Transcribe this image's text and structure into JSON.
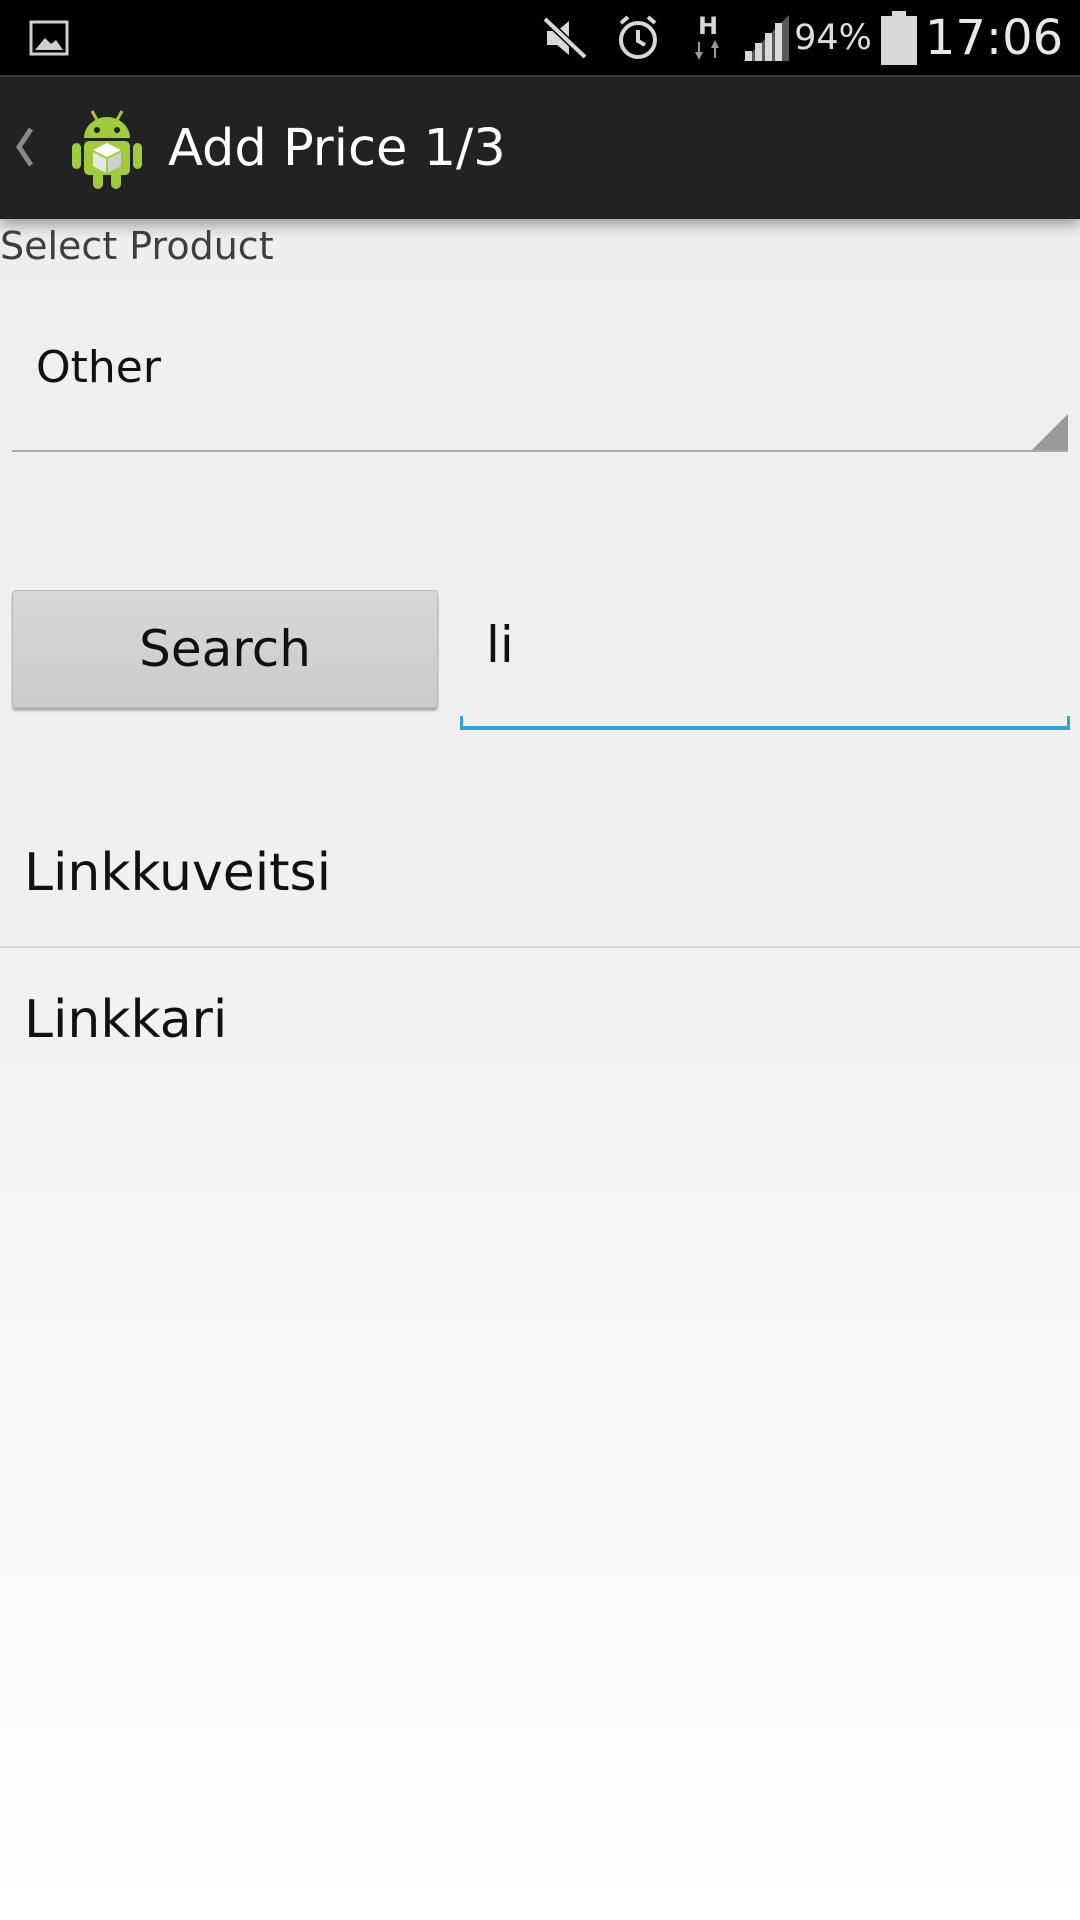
{
  "status_bar": {
    "icons": [
      "gallery-icon",
      "mute-icon",
      "alarm-icon",
      "hspa-data-icon",
      "signal-icon",
      "battery-icon"
    ],
    "battery_percent": "94%",
    "time": "17:06"
  },
  "action_bar": {
    "title": "Add Price 1/3",
    "icon": "android-app-icon",
    "back_icon": "chevron-left-icon"
  },
  "form": {
    "section_label": "Select Product",
    "product_spinner_value": "Other",
    "search_button_label": "Search",
    "search_query": "li"
  },
  "results": [
    {
      "label": "Linkkuveitsi"
    },
    {
      "label": "Linkkari"
    }
  ],
  "colors": {
    "status_bar_bg": "#000000",
    "action_bar_bg": "#222222",
    "accent": "#33a3d6",
    "button_bg": "#cfcfcf"
  }
}
